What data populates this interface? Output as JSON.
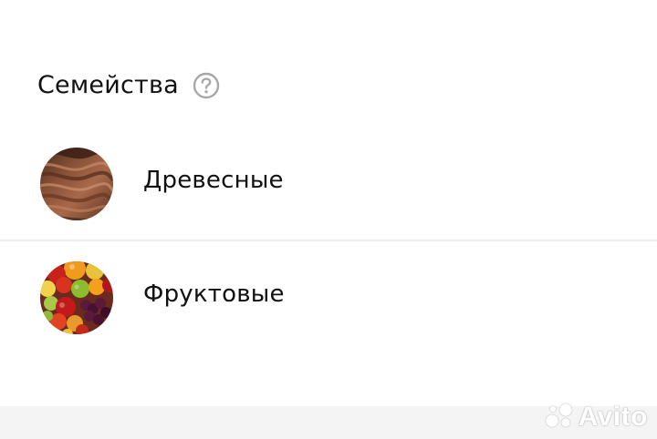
{
  "section": {
    "title": "Семейства",
    "help_icon": "question-circle-icon"
  },
  "families": [
    {
      "label": "Древесные",
      "thumb": "wood-texture-image"
    },
    {
      "label": "Фруктовые",
      "thumb": "fruit-assortment-image"
    }
  ],
  "watermark": {
    "text": "Avito",
    "icon": "avito-logo-dots"
  },
  "colors": {
    "page_bg": "#f4f4f4",
    "card_bg": "#ffffff",
    "text": "#111111",
    "help_icon": "#a8a8a8",
    "divider": "#ececec"
  }
}
